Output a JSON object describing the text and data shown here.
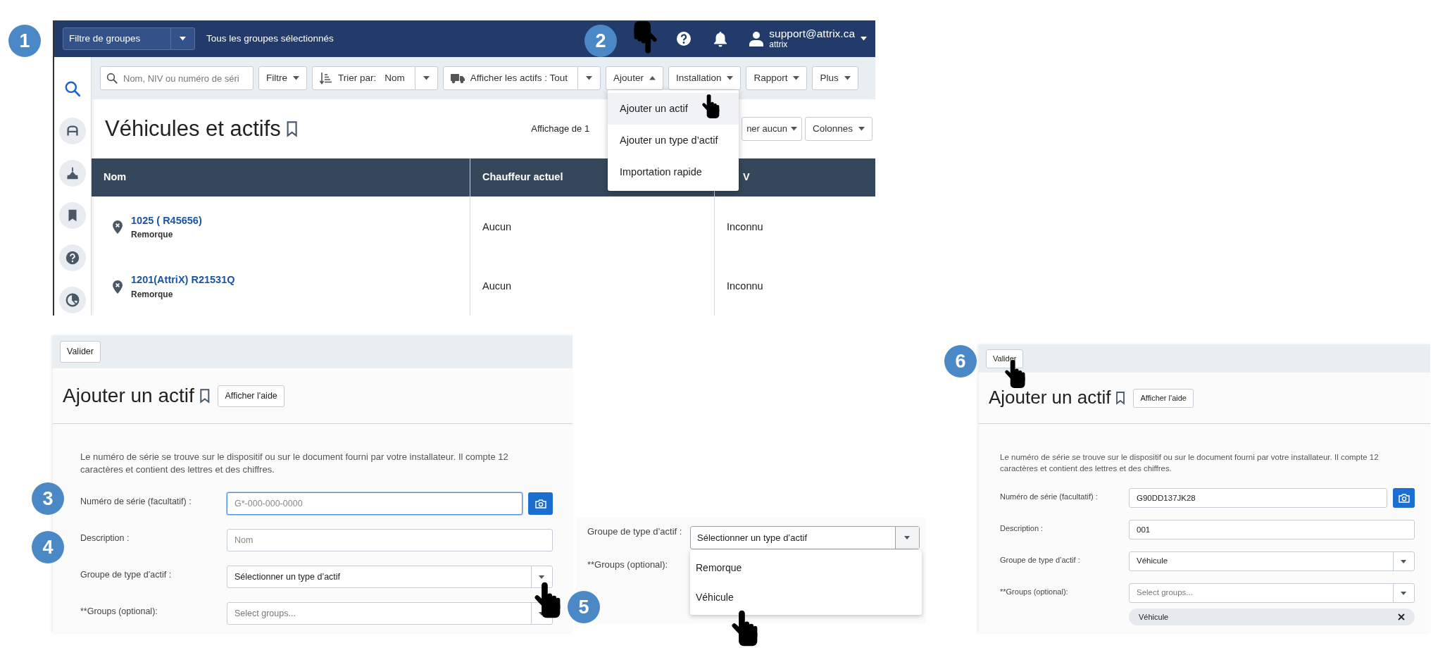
{
  "step_badges": [
    {
      "label": "1"
    },
    {
      "label": "2"
    },
    {
      "label": "3"
    },
    {
      "label": "4"
    },
    {
      "label": "5"
    },
    {
      "label": "6"
    }
  ],
  "asset_list": {
    "header": {
      "group_filter": "Filtre de groupes",
      "groups_status": "Tous les groupes sélectionnés",
      "user_email": "support@attrix.ca",
      "user_account": "attrix"
    },
    "sidebar": {
      "items": [
        {
          "kind": "search",
          "selected": true
        },
        {
          "kind": "vehicle",
          "selected": false
        },
        {
          "kind": "site",
          "selected": false
        },
        {
          "kind": "bookmark",
          "selected": false
        },
        {
          "kind": "help",
          "selected": false
        },
        {
          "kind": "chart",
          "selected": false
        }
      ]
    },
    "toolbar": {
      "search_placeholder": "Nom, NIV ou numéro de séri",
      "buttons": [
        {
          "kind": "menu",
          "label": "Filtre",
          "expanded": false
        },
        {
          "kind": "sort",
          "label": "Trier par:",
          "value": "Nom"
        },
        {
          "kind": "split",
          "label": "Afficher les actifs : Tout"
        },
        {
          "kind": "menu",
          "label": "Ajouter",
          "expanded": true
        },
        {
          "kind": "menu",
          "label": "Installation",
          "expanded": false
        },
        {
          "kind": "menu",
          "label": "Rapport",
          "expanded": false
        },
        {
          "kind": "menu",
          "label": "Plus",
          "expanded": false
        }
      ]
    },
    "title": "Véhicules et actifs",
    "showing_text": "Affichage de 1",
    "select_button": "ner aucun",
    "columns_button": "Colonnes",
    "table": {
      "columns": [
        "Nom",
        "Chauffeur actuel",
        "V"
      ],
      "rows": [
        {
          "name": "1025 ( R45656)",
          "type": "Remorque",
          "driver": "Aucun",
          "column_3": "Inconnu"
        },
        {
          "name": "1201(AttriX) R21531Q",
          "type": "Remorque",
          "driver": "Aucun",
          "column_3": "Inconnu"
        }
      ]
    },
    "add_menu": {
      "items": [
        {
          "label": "Ajouter un actif",
          "selected": true
        },
        {
          "label": "Ajouter un type d’actif",
          "selected": false
        },
        {
          "label": "Importation rapide",
          "selected": false
        }
      ]
    }
  },
  "add_asset_form": {
    "toolbar_button": "Valider",
    "title": "Ajouter un actif",
    "help_button": "Afficher l'aide",
    "intro": "Le numéro de série se trouve sur le dispositif ou sur le document fourni par votre installateur. Il compte 12 caractères et contient des lettres et des chiffres.",
    "fields": [
      {
        "kind": "serial",
        "label": "Numéro de série (facultatif) :",
        "placeholder": "G*-000-000-0000",
        "focused": true
      },
      {
        "kind": "text",
        "label": "Description :",
        "placeholder": "Nom",
        "focused": false
      },
      {
        "kind": "select",
        "label": "Groupe de type d’actif :",
        "value": "Sélectionner un type d’actif",
        "focused": false
      },
      {
        "kind": "multiselect",
        "label": "**Groups (optional):",
        "placeholder": "Select groups...",
        "focused": false
      }
    ]
  },
  "type_dropdown": {
    "label": "Groupe de type d’actif :",
    "value": "Sélectionner un type d’actif",
    "options": [
      "Remorque",
      "Véhicule"
    ],
    "groups_label": "**Groups (optional):"
  },
  "filled_form": {
    "toolbar_button": "Valider",
    "title": "Ajouter un actif",
    "help_button": "Afficher l'aide",
    "intro": "Le numéro de série se trouve sur le dispositif ou sur le document fourni par votre installateur. Il compte 12 caractères et contient des lettres et des chiffres.",
    "fields": [
      {
        "kind": "serial",
        "label": "Numéro de série (facultatif) :",
        "value": "G90DD137JK28",
        "focused": false
      },
      {
        "kind": "text",
        "label": "Description :",
        "value": "001",
        "focused": false
      },
      {
        "kind": "select",
        "label": "Groupe de type d’actif :",
        "value": "Véhicule",
        "focused": false
      },
      {
        "kind": "multiselect",
        "label": "**Groups (optional):",
        "placeholder": "Select groups...",
        "focused": false,
        "chips": [
          "Véhicule"
        ]
      }
    ]
  }
}
